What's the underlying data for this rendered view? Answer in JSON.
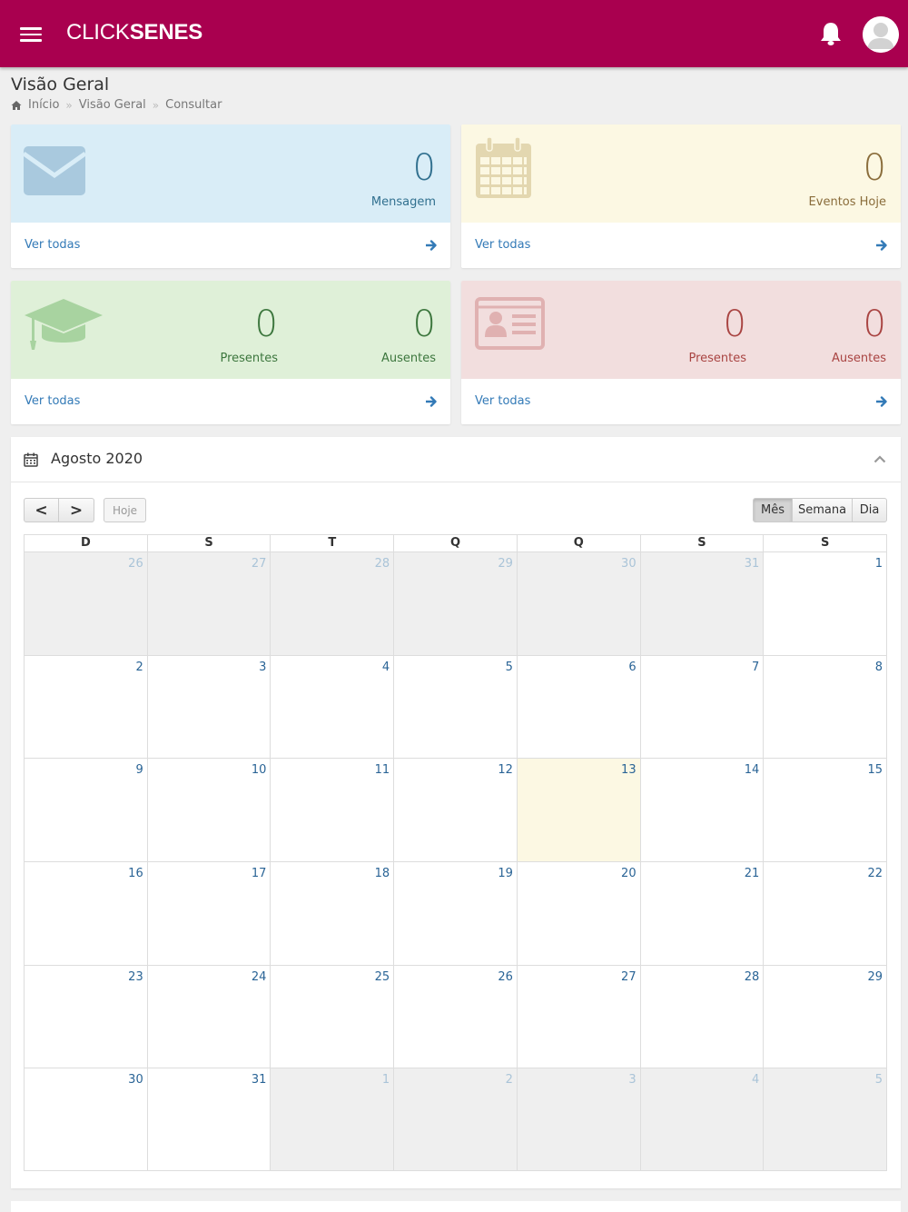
{
  "header": {
    "brand_light": "CLICK",
    "brand_bold": "SENES"
  },
  "page": {
    "title": "Visão Geral",
    "breadcrumb": [
      "Início",
      "Visão Geral",
      "Consultar"
    ]
  },
  "cards": {
    "messages": {
      "value": "0",
      "caption": "Mensagem",
      "link": "Ver todas",
      "icon": "envelope-icon"
    },
    "events": {
      "value": "0",
      "caption": "Eventos Hoje",
      "link": "Ver todas",
      "icon": "calendar-icon"
    },
    "students": {
      "present_value": "0",
      "present_caption": "Presentes",
      "absent_value": "0",
      "absent_caption": "Ausentes",
      "link": "Ver todas",
      "icon": "graduation-cap-icon"
    },
    "staff": {
      "present_value": "0",
      "present_caption": "Presentes",
      "absent_value": "0",
      "absent_caption": "Ausentes",
      "link": "Ver todas",
      "icon": "id-card-icon"
    }
  },
  "calendar": {
    "title": "Agosto 2020",
    "prev_label": "<",
    "next_label": ">",
    "today_label": "Hoje",
    "views": [
      "Mês",
      "Semana",
      "Dia"
    ],
    "active_view": "Mês",
    "weekdays": [
      "D",
      "S",
      "T",
      "Q",
      "Q",
      "S",
      "S"
    ],
    "weeks": [
      [
        {
          "d": "26",
          "o": true
        },
        {
          "d": "27",
          "o": true
        },
        {
          "d": "28",
          "o": true
        },
        {
          "d": "29",
          "o": true
        },
        {
          "d": "30",
          "o": true
        },
        {
          "d": "31",
          "o": true
        },
        {
          "d": "1"
        }
      ],
      [
        {
          "d": "2"
        },
        {
          "d": "3"
        },
        {
          "d": "4"
        },
        {
          "d": "5"
        },
        {
          "d": "6"
        },
        {
          "d": "7"
        },
        {
          "d": "8"
        }
      ],
      [
        {
          "d": "9"
        },
        {
          "d": "10"
        },
        {
          "d": "11"
        },
        {
          "d": "12"
        },
        {
          "d": "13",
          "t": true
        },
        {
          "d": "14"
        },
        {
          "d": "15"
        }
      ],
      [
        {
          "d": "16"
        },
        {
          "d": "17"
        },
        {
          "d": "18"
        },
        {
          "d": "19"
        },
        {
          "d": "20"
        },
        {
          "d": "21"
        },
        {
          "d": "22"
        }
      ],
      [
        {
          "d": "23"
        },
        {
          "d": "24"
        },
        {
          "d": "25"
        },
        {
          "d": "26"
        },
        {
          "d": "27"
        },
        {
          "d": "28"
        },
        {
          "d": "29"
        }
      ],
      [
        {
          "d": "30"
        },
        {
          "d": "31"
        },
        {
          "d": "1",
          "o": true
        },
        {
          "d": "2",
          "o": true
        },
        {
          "d": "3",
          "o": true
        },
        {
          "d": "4",
          "o": true
        },
        {
          "d": "5",
          "o": true
        }
      ]
    ]
  },
  "colors": {
    "brand": "#a9004f",
    "info_bg": "#d9edf7",
    "warning_bg": "#fcf8e3",
    "success_bg": "#dff0d8",
    "danger_bg": "#f2dede",
    "link": "#337ab7"
  }
}
